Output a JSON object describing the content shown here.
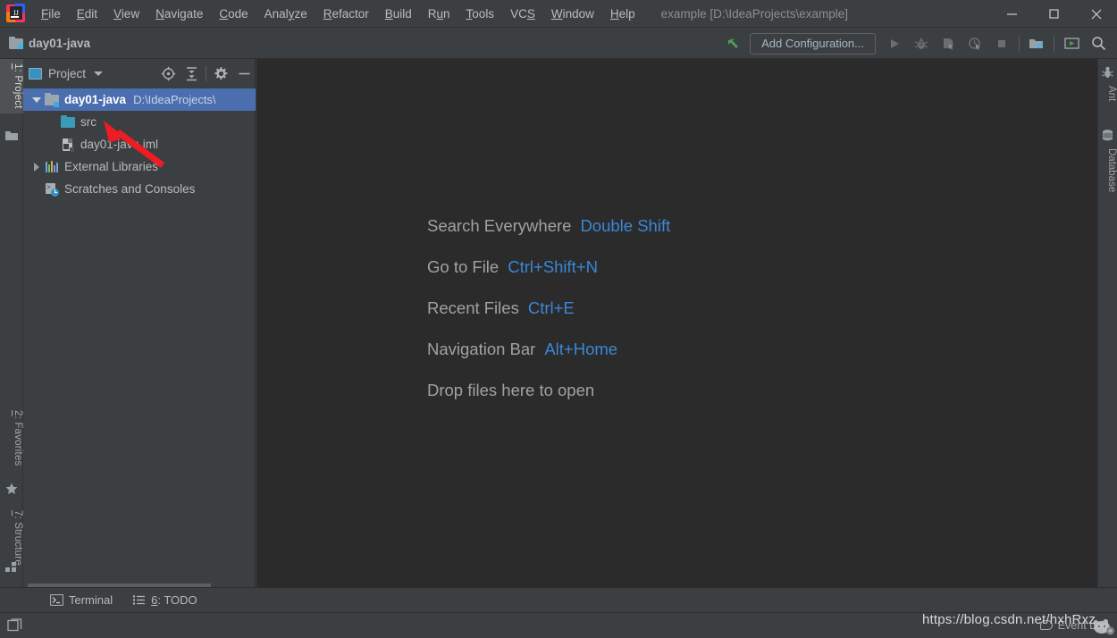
{
  "window": {
    "title": "example [D:\\IdeaProjects\\example]",
    "minimize_label": "Minimize",
    "maximize_label": "Maximize",
    "close_label": "Close"
  },
  "menubar": {
    "items": [
      {
        "label": "File",
        "mnemonic": "F"
      },
      {
        "label": "Edit",
        "mnemonic": "E"
      },
      {
        "label": "View",
        "mnemonic": "V"
      },
      {
        "label": "Navigate",
        "mnemonic": "N"
      },
      {
        "label": "Code",
        "mnemonic": "C"
      },
      {
        "label": "Analyze",
        "mnemonic": "y"
      },
      {
        "label": "Refactor",
        "mnemonic": "R"
      },
      {
        "label": "Build",
        "mnemonic": "B"
      },
      {
        "label": "Run",
        "mnemonic": "u"
      },
      {
        "label": "Tools",
        "mnemonic": "T"
      },
      {
        "label": "VCS",
        "mnemonic": "S"
      },
      {
        "label": "Window",
        "mnemonic": "W"
      },
      {
        "label": "Help",
        "mnemonic": "H"
      }
    ]
  },
  "navbar": {
    "breadcrumb": "day01-java",
    "run_config": "Add Configuration...",
    "buttons": [
      {
        "name": "build-project",
        "label": "Build Project"
      },
      {
        "name": "run",
        "label": "Run"
      },
      {
        "name": "debug",
        "label": "Debug"
      },
      {
        "name": "run-with-coverage",
        "label": "Run with Coverage"
      },
      {
        "name": "profiler",
        "label": "Profiler"
      },
      {
        "name": "stop",
        "label": "Stop"
      },
      {
        "name": "project-structure",
        "label": "Project Structure"
      },
      {
        "name": "updates",
        "label": "Updates"
      },
      {
        "name": "search-everywhere",
        "label": "Search Everywhere"
      }
    ]
  },
  "left_strip": {
    "tabs": [
      {
        "label": "1: Project",
        "number": "1",
        "rest": ": Project",
        "active": true
      },
      {
        "label": "2: Favorites",
        "number": "2",
        "rest": ": Favorites",
        "active": false
      },
      {
        "label": "7: Structure",
        "number": "7",
        "rest": ": Structure",
        "active": false
      }
    ]
  },
  "right_strip": {
    "tabs": [
      {
        "label": "Ant"
      },
      {
        "label": "Database"
      }
    ]
  },
  "project_panel": {
    "title": "Project",
    "toolbar": [
      {
        "name": "select-opened-file",
        "label": "Select Opened File"
      },
      {
        "name": "collapse-all",
        "label": "Collapse All"
      },
      {
        "name": "settings",
        "label": "Settings"
      },
      {
        "name": "hide",
        "label": "Hide"
      }
    ],
    "tree": [
      {
        "label": "day01-java",
        "path": "D:\\IdeaProjects\\",
        "icon": "module-folder-icon",
        "expanded": true,
        "selected": true,
        "indent": 0,
        "bold": true
      },
      {
        "label": "src",
        "path": "",
        "icon": "source-folder-icon",
        "expanded": null,
        "selected": false,
        "indent": 1,
        "bold": false
      },
      {
        "label": "day01-java.iml",
        "path": "",
        "icon": "iml-file-icon",
        "expanded": null,
        "selected": false,
        "indent": 1,
        "bold": false
      },
      {
        "label": "External Libraries",
        "path": "",
        "icon": "libraries-icon",
        "expanded": false,
        "selected": false,
        "indent": 0,
        "bold": false
      },
      {
        "label": "Scratches and Consoles",
        "path": "",
        "icon": "scratches-icon",
        "expanded": null,
        "selected": false,
        "indent": 0,
        "bold": false
      }
    ]
  },
  "editor": {
    "hints": [
      {
        "action": "Search Everywhere",
        "shortcut": "Double Shift"
      },
      {
        "action": "Go to File",
        "shortcut": "Ctrl+Shift+N"
      },
      {
        "action": "Recent Files",
        "shortcut": "Ctrl+E"
      },
      {
        "action": "Navigation Bar",
        "shortcut": "Alt+Home"
      },
      {
        "action": "Drop files here to open",
        "shortcut": ""
      }
    ]
  },
  "bottom_tabs": [
    {
      "label": "Terminal",
      "mnemonic": "",
      "prefix": "",
      "icon": "terminal-icon"
    },
    {
      "label": "6: TODO",
      "mnemonic": "6",
      "prefix": ": TODO",
      "icon": "todo-icon"
    }
  ],
  "statusbar": {
    "event_log": "Event Log",
    "layout_label": "Layout"
  },
  "watermark": {
    "text": "https://blog.csdn.net/hxhRxz"
  },
  "colors": {
    "panel_bg": "#3c3f41",
    "editor_bg": "#2b2b2b",
    "selection_blue": "#4b6eaf",
    "accent_blue": "#3b87d7",
    "text": "#bbbbbb",
    "annotation_red": "#ee1c25"
  }
}
